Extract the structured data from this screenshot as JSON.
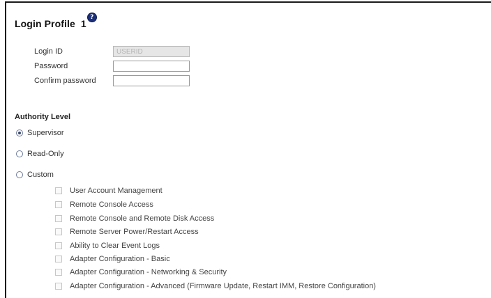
{
  "profile": {
    "title": "Login Profile",
    "number": "1",
    "help_icon_glyph": "?"
  },
  "fields": [
    {
      "label": "Login ID",
      "value": "USERID",
      "disabled": true
    },
    {
      "label": "Password",
      "value": "",
      "disabled": false
    },
    {
      "label": "Confirm password",
      "value": "",
      "disabled": false
    }
  ],
  "authority": {
    "heading": "Authority Level",
    "options": [
      {
        "label": "Supervisor",
        "checked": true
      },
      {
        "label": "Read-Only",
        "checked": false
      },
      {
        "label": "Custom",
        "checked": false
      }
    ],
    "custom_permissions": [
      "User Account Management",
      "Remote Console Access",
      "Remote Console and Remote Disk Access",
      "Remote Server Power/Restart Access",
      "Ability to Clear Event Logs",
      "Adapter Configuration - Basic",
      "Adapter Configuration - Networking & Security",
      "Adapter Configuration - Advanced (Firmware Update, Restart IMM, Restore Configuration)"
    ]
  }
}
